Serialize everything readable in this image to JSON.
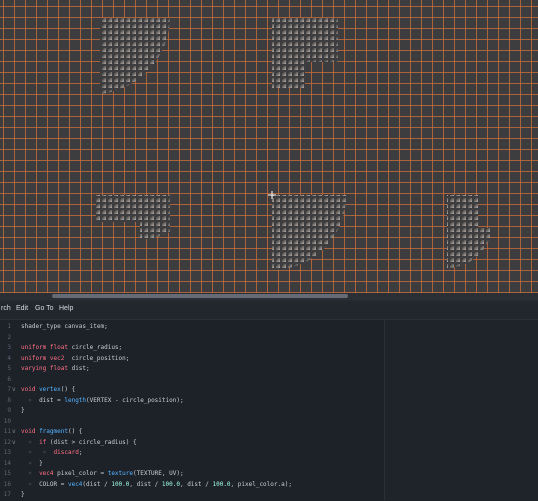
{
  "menu": {
    "items": [
      {
        "label": "rch",
        "x": 1
      },
      {
        "label": "Edit",
        "x": 16
      },
      {
        "label": "Go To",
        "x": 35
      },
      {
        "label": "Help",
        "x": 59
      }
    ]
  },
  "editor": {
    "lines": [
      {
        "num": "1",
        "fold": "",
        "tokens": [
          {
            "t": "shader_type canvas_item;",
            "c": "plain"
          }
        ]
      },
      {
        "num": "2",
        "fold": "",
        "tokens": []
      },
      {
        "num": "3",
        "fold": "",
        "tokens": [
          {
            "t": "uniform float ",
            "c": "kw"
          },
          {
            "t": "circle_radius;",
            "c": "plain"
          }
        ]
      },
      {
        "num": "4",
        "fold": "",
        "tokens": [
          {
            "t": "uniform vec2  ",
            "c": "kw"
          },
          {
            "t": "circle_position;",
            "c": "plain"
          }
        ]
      },
      {
        "num": "5",
        "fold": "",
        "tokens": [
          {
            "t": "varying float ",
            "c": "kw"
          },
          {
            "t": "dist;",
            "c": "plain"
          }
        ]
      },
      {
        "num": "6",
        "fold": "",
        "tokens": []
      },
      {
        "num": "7",
        "fold": "v",
        "tokens": [
          {
            "t": "void ",
            "c": "kw"
          },
          {
            "t": "vertex",
            "c": "fn"
          },
          {
            "t": "() {",
            "c": "plain"
          }
        ]
      },
      {
        "num": "8",
        "fold": "",
        "tokens": [
          {
            "t": "  »  ",
            "c": "ws"
          },
          {
            "t": "dist = ",
            "c": "plain"
          },
          {
            "t": "length",
            "c": "fn"
          },
          {
            "t": "(VERTEX - circle_position);",
            "c": "plain"
          }
        ]
      },
      {
        "num": "9",
        "fold": "",
        "tokens": [
          {
            "t": "}",
            "c": "plain"
          }
        ]
      },
      {
        "num": "10",
        "fold": "",
        "tokens": []
      },
      {
        "num": "11",
        "fold": "v",
        "tokens": [
          {
            "t": "void ",
            "c": "kw"
          },
          {
            "t": "fragment",
            "c": "fn"
          },
          {
            "t": "() {",
            "c": "plain"
          }
        ]
      },
      {
        "num": "12",
        "fold": "v",
        "tokens": [
          {
            "t": "  »  ",
            "c": "ws"
          },
          {
            "t": "if ",
            "c": "kw"
          },
          {
            "t": "(dist > circle_radius) {",
            "c": "plain"
          }
        ]
      },
      {
        "num": "13",
        "fold": "",
        "tokens": [
          {
            "t": "  »   »  ",
            "c": "ws"
          },
          {
            "t": "discard",
            "c": "kw"
          },
          {
            "t": ";",
            "c": "plain"
          }
        ]
      },
      {
        "num": "14",
        "fold": "",
        "tokens": [
          {
            "t": "  »  ",
            "c": "ws"
          },
          {
            "t": "}",
            "c": "plain"
          }
        ]
      },
      {
        "num": "15",
        "fold": "",
        "tokens": [
          {
            "t": "  »  ",
            "c": "ws"
          },
          {
            "t": "vec4 ",
            "c": "kw"
          },
          {
            "t": "pixel_color = ",
            "c": "plain"
          },
          {
            "t": "texture",
            "c": "fn"
          },
          {
            "t": "(TEXTURE, UV);",
            "c": "plain"
          }
        ]
      },
      {
        "num": "16",
        "fold": "",
        "tokens": [
          {
            "t": "  »  ",
            "c": "ws"
          },
          {
            "t": "COLOR = ",
            "c": "plain"
          },
          {
            "t": "vec4",
            "c": "fn"
          },
          {
            "t": "(dist / ",
            "c": "plain"
          },
          {
            "t": "100.0",
            "c": "num"
          },
          {
            "t": ", dist / ",
            "c": "plain"
          },
          {
            "t": "100.0",
            "c": "num"
          },
          {
            "t": ", dist / ",
            "c": "plain"
          },
          {
            "t": "100.0",
            "c": "num"
          },
          {
            "t": ", pixel_color.a);",
            "c": "plain"
          }
        ]
      },
      {
        "num": "17",
        "fold": "",
        "tokens": [
          {
            "t": "}",
            "c": "plain"
          }
        ]
      }
    ]
  },
  "colors": {
    "viewport_bg": "#3d3d40",
    "grid": "#ce703c",
    "editor_bg": "#1d2229",
    "keyword": "#ff7085",
    "function": "#57b3ff",
    "number": "#a1ffe0"
  },
  "icons": {
    "origin_marker": "crosshair-icon",
    "fold_marker": "chevron-down-icon",
    "tab_marker": "tab-arrow-icon"
  }
}
